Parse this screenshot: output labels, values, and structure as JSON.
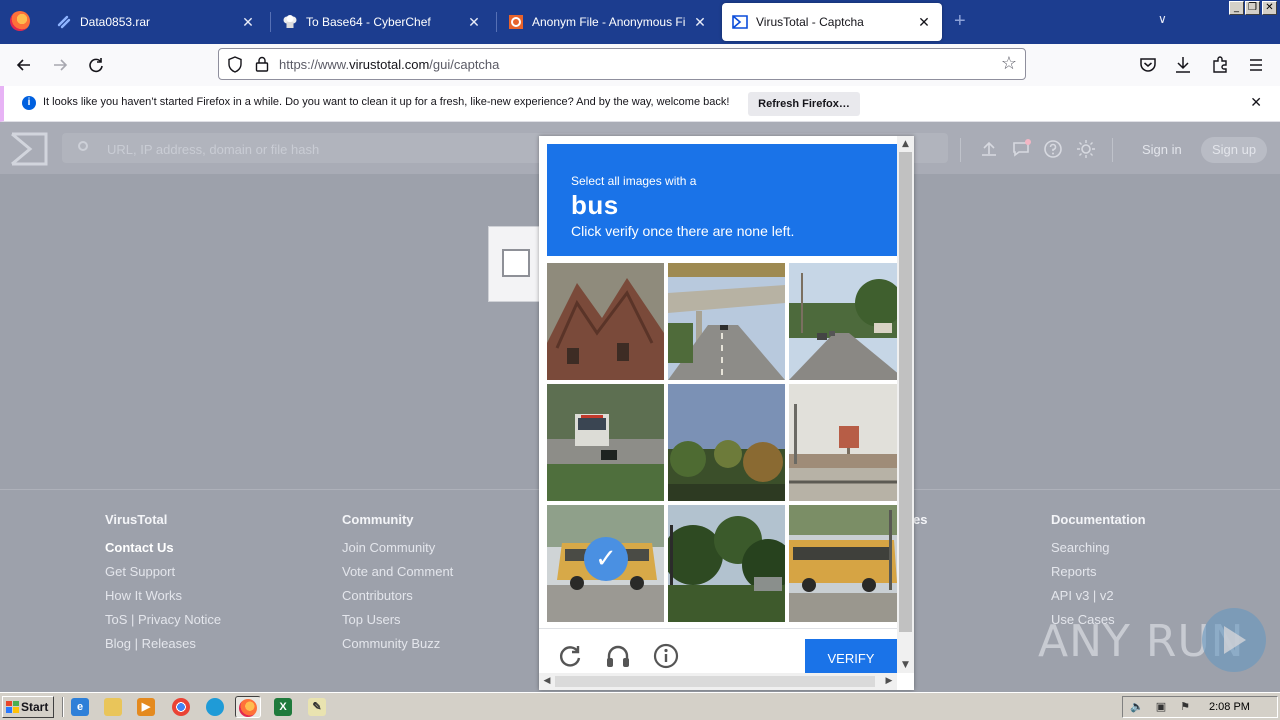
{
  "browser": {
    "tabs": [
      {
        "title": "Data0853.rar",
        "icon": "link-icon",
        "active": false
      },
      {
        "title": "To Base64 - CyberChef",
        "icon": "chef-hat-icon",
        "active": false
      },
      {
        "title": "Anonym File - Anonymous File Uplo",
        "icon": "anonymous-logo-icon",
        "active": false
      },
      {
        "title": "VirusTotal - Captcha",
        "icon": "virustotal-logo-icon",
        "active": true
      }
    ],
    "close_glyph": "✕",
    "new_tab_glyph": "+",
    "tab_list_glyph": "∨",
    "window_controls": [
      "_",
      "❐",
      "✕"
    ],
    "url": {
      "prefix": "https://www.",
      "domain": "virustotal.com",
      "path": "/gui/captcha"
    }
  },
  "notification": {
    "message": "It looks like you haven’t started Firefox in a while. Do you want to clean it up for a fresh, like-new experience? And by the way, welcome back!",
    "button": "Refresh Firefox…",
    "close_glyph": "✕"
  },
  "virustotal": {
    "search_placeholder": "URL, IP address, domain or file hash",
    "sign_in": "Sign in",
    "sign_up": "Sign up",
    "footer": [
      {
        "heading": "VirusTotal",
        "links": [
          "Contact Us",
          "Get Support",
          "How It Works",
          "ToS | Privacy Notice",
          "Blog | Releases"
        ]
      },
      {
        "heading": "Community",
        "links": [
          "Join Community",
          "Vote and Comment",
          "Contributors",
          "Top Users",
          "Community Buzz"
        ]
      },
      {
        "heading": "es",
        "links": []
      },
      {
        "heading": "Documentation",
        "links": [
          "Searching",
          "Reports",
          "API v3 | v2",
          "Use Cases"
        ]
      }
    ]
  },
  "captcha": {
    "instruction_line1": "Select all images with a",
    "target_word": "bus",
    "instruction_line3": "Click verify once there are none left.",
    "verify_label": "VERIFY",
    "selected_tiles": [
      6
    ],
    "tiles": [
      "brick-house-roof-image",
      "highway-overpass-image",
      "suburban-street-image",
      "transit-bus-on-road-image",
      "trees-and-sky-image",
      "billboard-lot-image",
      "school-bus-image",
      "green-trees-image",
      "school-bus-parked-image"
    ],
    "check_glyph": "✓"
  },
  "watermark": {
    "text": "ANY RUN"
  },
  "taskbar": {
    "start_label": "Start",
    "clock": "2:08 PM"
  },
  "colors": {
    "tabstrip": "#1c3d8f",
    "captcha_blue": "#1a73e8",
    "overlay_gray": "#9da1ab"
  }
}
